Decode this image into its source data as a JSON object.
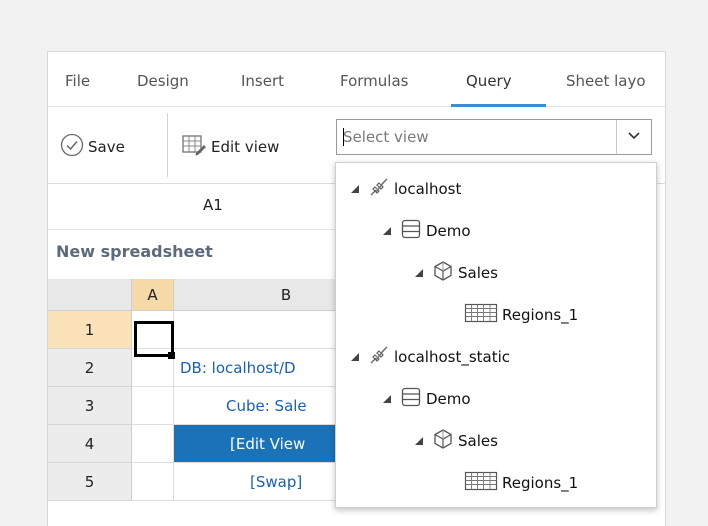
{
  "ribbon": {
    "tabs": [
      {
        "label": "File"
      },
      {
        "label": "Design"
      },
      {
        "label": "Insert"
      },
      {
        "label": "Formulas"
      },
      {
        "label": "Query",
        "active": true
      },
      {
        "label": "Sheet layo"
      }
    ]
  },
  "toolbar": {
    "save_label": "Save",
    "edit_view_label": "Edit view",
    "select_view_placeholder": "Select view"
  },
  "cell_reference": "A1",
  "sheet_title": "New spreadsheet",
  "grid": {
    "columns": [
      {
        "label": ""
      },
      {
        "label": "A"
      },
      {
        "label": "B"
      }
    ],
    "rows": [
      {
        "num": "1",
        "b": ""
      },
      {
        "num": "2",
        "b": "DB: localhost/D"
      },
      {
        "num": "3",
        "b": "Cube: Sale"
      },
      {
        "num": "4",
        "b": "[Edit View"
      },
      {
        "num": "5",
        "b": "[Swap]"
      }
    ]
  },
  "view_tree": [
    {
      "label": "localhost",
      "icon": "connection-icon",
      "level": 0
    },
    {
      "label": "Demo",
      "icon": "database-icon",
      "level": 1
    },
    {
      "label": "Sales",
      "icon": "cube-icon",
      "level": 2
    },
    {
      "label": "Regions_1",
      "icon": "table-view-icon",
      "level": 3
    },
    {
      "label": "localhost_static",
      "icon": "connection-icon",
      "level": 0
    },
    {
      "label": "Demo",
      "icon": "database-icon",
      "level": 1
    },
    {
      "label": "Sales",
      "icon": "cube-icon",
      "level": 2
    },
    {
      "label": "Regions_1",
      "icon": "table-view-icon",
      "level": 3
    }
  ],
  "colors": {
    "accent": "#3a8ed8",
    "highlight_cell": "#1a73b8",
    "selected_header": "#f5d9a6",
    "link_text": "#1a5fb4"
  }
}
